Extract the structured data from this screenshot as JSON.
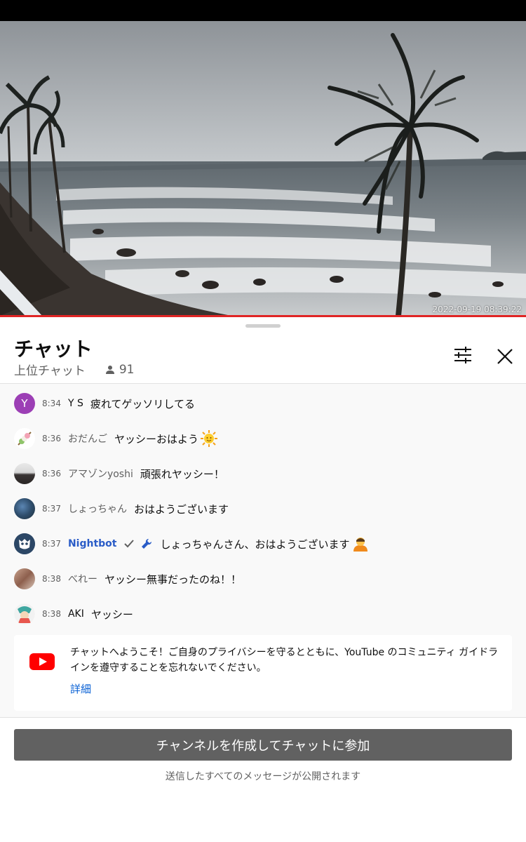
{
  "video": {
    "timestamp": "2022-09-19 08:39:22"
  },
  "chat": {
    "title": "チャット",
    "mode_label": "上位チャット",
    "viewer_count": "91",
    "messages": [
      {
        "time": "8:34",
        "author": "Y S",
        "text": "疲れてゲッソリしてる",
        "avatar_letter": "Y",
        "avatar_color": "#9c27b0"
      },
      {
        "time": "8:36",
        "author": "おだんご",
        "text": "ヤッシーおはよう"
      },
      {
        "time": "8:36",
        "author": "アマゾンyoshi",
        "text": "頑張れヤッシー！"
      },
      {
        "time": "8:37",
        "author": "しょっちゃん",
        "text": "おはようございます"
      },
      {
        "time": "8:37",
        "author": "Nightbot",
        "text": "しょっちゃんさん、おはようございます"
      },
      {
        "time": "8:38",
        "author": "べれー",
        "text": "ヤッシー無事だったのね！！"
      },
      {
        "time": "8:38",
        "author": "AKI",
        "text": "ヤッシー"
      }
    ],
    "welcome": {
      "text": "チャットへようこそ！ご自身のプライバシーを守るとともに、YouTube のコミュニティ ガイドラインを遵守することを忘れないでください。",
      "link": "詳細"
    },
    "join_button": "チャンネルを作成してチャットに参加",
    "footer_note": "送信したすべてのメッセージが公開されます"
  },
  "colors": {
    "progress": "#e02424",
    "moderator_name": "#2a5cc7",
    "link": "#065fd4",
    "join_button": "#616161"
  }
}
